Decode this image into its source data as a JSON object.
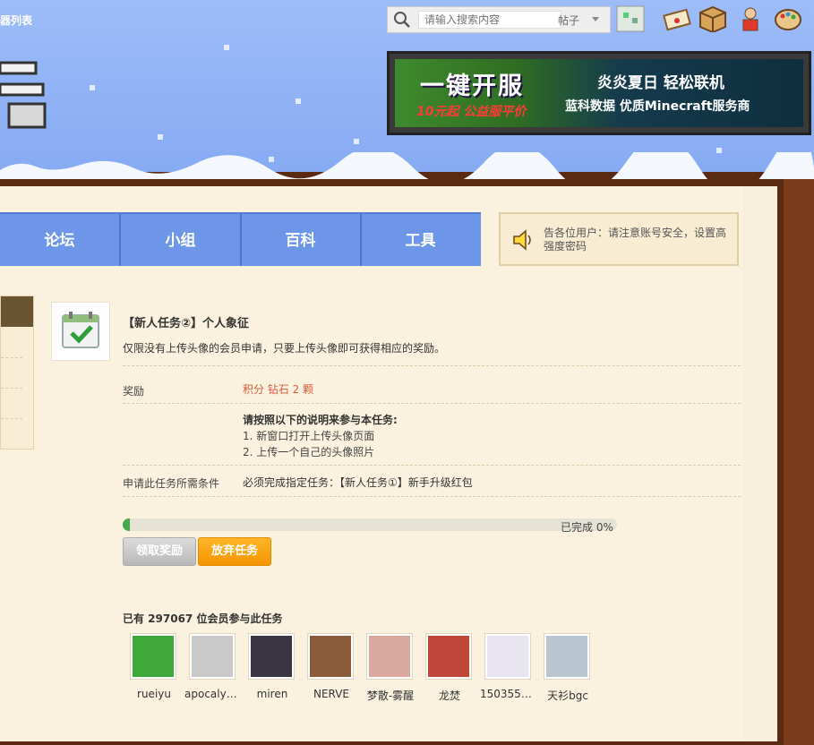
{
  "topbar": {
    "server_link": "器列表",
    "search_placeholder": "请输入搜索内容",
    "search_scope": "帖子"
  },
  "banner": {
    "left_text": "一键开服",
    "left_sub": "10元起 公益服平价",
    "right_line1": "炎炎夏日 轻松联机",
    "right_line2": "蓝科数据 优质Minecraft服务商"
  },
  "nav": {
    "items": [
      "论坛",
      "小组",
      "百科",
      "工具"
    ]
  },
  "notice": {
    "text": "告各位用户：请注意账号安全，设置高强度密码"
  },
  "task": {
    "title": "【新人任务②】个人象征",
    "description": "仅限没有上传头像的会员申请，只要上传头像即可获得相应的奖励。",
    "reward_label": "奖励",
    "reward_value": "积分 钻石 2 颗",
    "instructions_heading": "请按照以下的说明来参与本任务:",
    "instructions": [
      "1. 新窗口打开上传头像页面",
      "2. 上传一个自己的头像照片"
    ],
    "condition_label": "申请此任务所需条件",
    "condition_value": "必须完成指定任务：【新人任务①】新手升级红包",
    "progress_text": "已完成 0%",
    "progress_fraction": 0.0,
    "claim_button": "领取奖励",
    "abandon_button": "放弃任务"
  },
  "participants": {
    "heading": "已有 297067 位会员参与此任务",
    "users": [
      {
        "name": "rueiyu",
        "color": "#3fa83a"
      },
      {
        "name": "apocalyps...",
        "color": "#c9c9c9"
      },
      {
        "name": "miren",
        "color": "#3b3442"
      },
      {
        "name": "NERVE",
        "color": "#8a5a3a"
      },
      {
        "name": "梦散-雾醒",
        "color": "#d9a9a0"
      },
      {
        "name": "龙焚",
        "color": "#c0463a"
      },
      {
        "name": "1503559...",
        "color": "#e8e4f0"
      },
      {
        "name": "天衫bgc",
        "color": "#b9c6cf"
      }
    ]
  },
  "colors": {
    "nav_bg": "#6d95e8",
    "paper": "#faf2de",
    "frame": "#7a3b1b",
    "reward_text": "#e05a3a",
    "abandon_btn": "#f49400",
    "progress_fill": "#45a84a"
  }
}
